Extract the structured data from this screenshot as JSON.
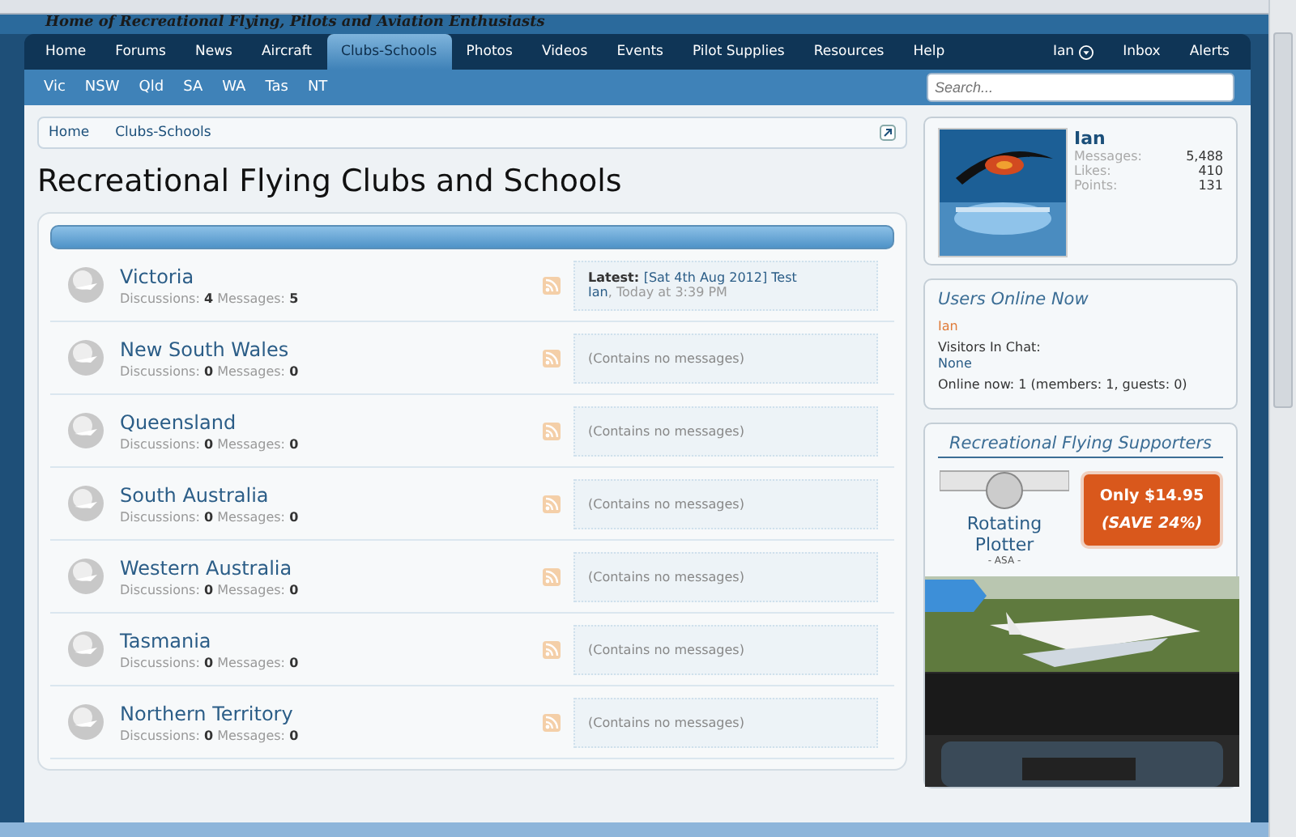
{
  "site": {
    "tagline": "Home of Recreational Flying, Pilots and Aviation Enthusiasts"
  },
  "nav": {
    "tabs": [
      {
        "label": "Home",
        "selected": false
      },
      {
        "label": "Forums",
        "selected": false
      },
      {
        "label": "News",
        "selected": false
      },
      {
        "label": "Aircraft",
        "selected": false
      },
      {
        "label": "Clubs-Schools",
        "selected": true
      },
      {
        "label": "Photos",
        "selected": false
      },
      {
        "label": "Videos",
        "selected": false
      },
      {
        "label": "Events",
        "selected": false
      },
      {
        "label": "Pilot Supplies",
        "selected": false
      },
      {
        "label": "Resources",
        "selected": false
      },
      {
        "label": "Help",
        "selected": false
      }
    ],
    "user": "Ian",
    "links": [
      "Inbox",
      "Alerts"
    ]
  },
  "subnav": {
    "items": [
      "Vic",
      "NSW",
      "Qld",
      "SA",
      "WA",
      "Tas",
      "NT"
    ],
    "search": {
      "placeholder": "Search..."
    }
  },
  "breadcrumb": [
    "Home",
    "Clubs-Schools"
  ],
  "title": "Recreational Flying Clubs and Schools",
  "forums": [
    {
      "name": "Victoria",
      "discussions_label": "Discussions:",
      "discussions": "4",
      "messages_label": "Messages:",
      "messages": "5",
      "latest": {
        "label": "Latest:",
        "thread": "[Sat 4th Aug 2012] Test",
        "user": "Ian",
        "separator": ",",
        "time": "Today at 3:39 PM"
      }
    },
    {
      "name": "New South Wales",
      "discussions_label": "Discussions:",
      "discussions": "0",
      "messages_label": "Messages:",
      "messages": "0",
      "empty": "(Contains no messages)"
    },
    {
      "name": "Queensland",
      "discussions_label": "Discussions:",
      "discussions": "0",
      "messages_label": "Messages:",
      "messages": "0",
      "empty": "(Contains no messages)"
    },
    {
      "name": "South Australia",
      "discussions_label": "Discussions:",
      "discussions": "0",
      "messages_label": "Messages:",
      "messages": "0",
      "empty": "(Contains no messages)"
    },
    {
      "name": "Western Australia",
      "discussions_label": "Discussions:",
      "discussions": "0",
      "messages_label": "Messages:",
      "messages": "0",
      "empty": "(Contains no messages)"
    },
    {
      "name": "Tasmania",
      "discussions_label": "Discussions:",
      "discussions": "0",
      "messages_label": "Messages:",
      "messages": "0",
      "empty": "(Contains no messages)"
    },
    {
      "name": "Northern Territory",
      "discussions_label": "Discussions:",
      "discussions": "0",
      "messages_label": "Messages:",
      "messages": "0",
      "empty": "(Contains no messages)"
    }
  ],
  "profile": {
    "name": "Ian",
    "stats": [
      {
        "label": "Messages:",
        "value": "5,488"
      },
      {
        "label": "Likes:",
        "value": "410"
      },
      {
        "label": "Points:",
        "value": "131"
      }
    ]
  },
  "online": {
    "title": "Users Online Now",
    "user": "Ian",
    "chat_label": "Visitors In Chat:",
    "chat_value": "None",
    "summary": "Online now: 1 (members: 1, guests: 0)"
  },
  "supporters": {
    "title": "Recreational Flying Supporters",
    "product": "Rotating Plotter",
    "brand": "- ASA -",
    "price": "Only $14.95",
    "save": "(SAVE 24%)"
  }
}
